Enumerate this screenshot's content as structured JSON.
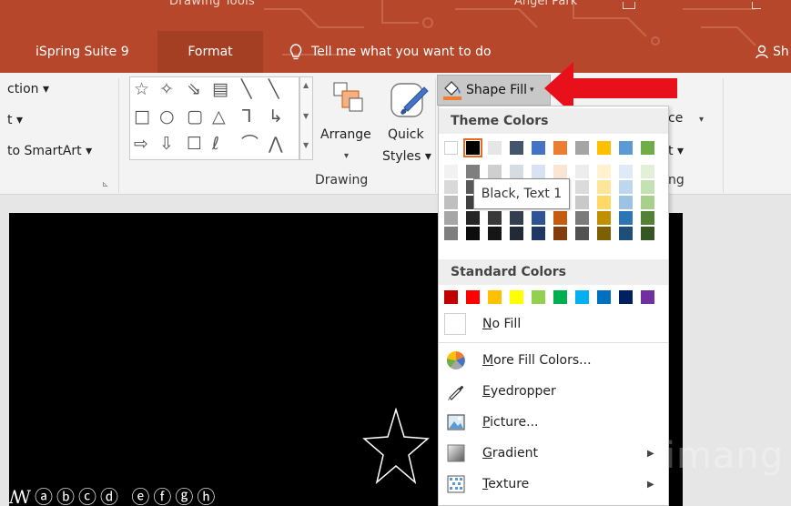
{
  "titlebar": {
    "context_title": "Drawing Tools",
    "user_name": "Angel Park",
    "tabs": [
      {
        "label": "iSpring Suite 9"
      },
      {
        "label": "Format"
      }
    ],
    "tell_me": "Tell me what you want to do",
    "share": "Sh"
  },
  "ribbon": {
    "left_items": [
      "ction ▾",
      "t ▾",
      "to SmartArt ▾"
    ],
    "arrange_label": "Arrange",
    "quick_label_1": "Quick",
    "quick_label_2": "Styles ▾",
    "drawing_group": "Drawing",
    "shape_fill_label": "Shape Fill",
    "right_item_1": "ce",
    "right_item_2": "t ▾",
    "right_group": "ng",
    "shapes_row1": [
      "☆",
      "✧",
      "⇘",
      "▤",
      "╲",
      "╲"
    ],
    "shapes_row2": [
      "□",
      "○",
      "▢",
      "△",
      "ᒣ",
      "↳"
    ],
    "shapes_row3": [
      "⇨",
      "⇩",
      "☐",
      "ℓ",
      "⌒",
      "⋀"
    ]
  },
  "shape_fill_menu": {
    "theme_heading": "Theme Colors",
    "standard_heading": "Standard Colors",
    "theme_colors": [
      "#ffffff",
      "#000000",
      "#e7e6e6",
      "#44546a",
      "#4472c4",
      "#ed7d31",
      "#a5a5a5",
      "#ffc000",
      "#5b9bd5",
      "#70ad47"
    ],
    "selected_index": 1,
    "theme_shades": [
      [
        "#f2f2f2",
        "#d9d9d9",
        "#bfbfbf",
        "#a6a6a6",
        "#7f7f7f"
      ],
      [
        "#7f7f7f",
        "#595959",
        "#404040",
        "#262626",
        "#0d0d0d"
      ],
      [
        "#d0cece",
        "#aeabab",
        "#757171",
        "#3a3838",
        "#171616"
      ],
      [
        "#d6dce4",
        "#adb9ca",
        "#8497b0",
        "#333f4f",
        "#222a35"
      ],
      [
        "#d9e2f3",
        "#b4c6e7",
        "#8eaadb",
        "#2f5496",
        "#1f3864"
      ],
      [
        "#fbe5d5",
        "#f7cbac",
        "#f4b183",
        "#c55a11",
        "#833c0b"
      ],
      [
        "#ededed",
        "#dbdbdb",
        "#c9c9c9",
        "#7b7b7b",
        "#525252"
      ],
      [
        "#fff2cc",
        "#fee599",
        "#ffd965",
        "#bf9000",
        "#7f6000"
      ],
      [
        "#deebf6",
        "#bdd7ee",
        "#9cc3e5",
        "#2e75b5",
        "#1f4e79"
      ],
      [
        "#e2efd9",
        "#c5e0b3",
        "#a8d08d",
        "#538135",
        "#375623"
      ]
    ],
    "standard_colors": [
      "#c00000",
      "#ff0000",
      "#ffc000",
      "#ffff00",
      "#92d050",
      "#00b050",
      "#00b0f0",
      "#0070c0",
      "#002060",
      "#7030a0"
    ],
    "tooltip": "Black, Text 1",
    "items": [
      {
        "label": "No Fill",
        "icon": "no-fill-icon"
      },
      {
        "label": "More Fill Colors...",
        "icon": "color-wheel-icon"
      },
      {
        "label": "Eyedropper",
        "icon": "eyedropper-icon"
      },
      {
        "label": "Picture...",
        "icon": "picture-icon"
      },
      {
        "label": "Gradient",
        "icon": "gradient-icon"
      },
      {
        "label": "Texture",
        "icon": "texture-icon"
      }
    ]
  },
  "slide": {
    "text": "ꟿⓐⓑⓒⓓ ⓔⓕⓖⓗ"
  },
  "watermark": "Quantrimang",
  "colors": {
    "accent": "#b7472a",
    "arrow": "#e8101a"
  }
}
